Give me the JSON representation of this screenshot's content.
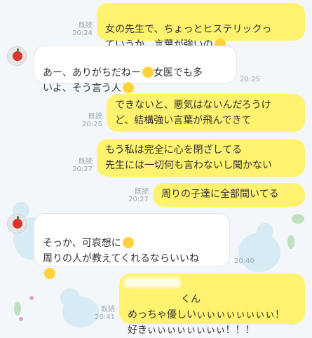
{
  "messages": [
    {
      "id": "m1",
      "side": "me",
      "lines": "女の先生で、ちょっとヒステリックっ\nていうか、言葉が強いの",
      "emoji": "crying-face-icon",
      "read": "既読",
      "time": "20:24"
    },
    {
      "id": "m2",
      "side": "them",
      "lines": "あー、ありがちだねー",
      "emoji": "grinning-sweat-icon",
      "lines2": "女医でも多\nいよ、そう言う人",
      "emoji2": "flushed-face-icon",
      "time": "20:25"
    },
    {
      "id": "m3",
      "side": "me",
      "lines": "できないと、悪気はないんだろうけ\nど、結構強い言葉が飛んできて",
      "read": "既読",
      "time": "20:25"
    },
    {
      "id": "m4",
      "side": "me",
      "lines": "もう私は完全に心を閉ざしてる\n先生には一切何も言わないし聞かない",
      "read": "既読",
      "time": "20:27"
    },
    {
      "id": "m5",
      "side": "me",
      "lines": "周りの子達に全部聞いてる",
      "read": "既読",
      "time": "20:27"
    },
    {
      "id": "m6",
      "side": "them",
      "lines": "そっか、可哀想に",
      "emoji": "pleading-face-icon",
      "lines2": "周りの人が教えてくれるならいいね",
      "emoji2": "smiling-face-icon",
      "time": "20:40"
    },
    {
      "id": "m7",
      "side": "me",
      "lines": "くん\nめっちゃ優しいぃぃぃぃぃぃぃぃ！\n好きぃぃぃぃぃぃぃぃ！！！",
      "read": "既読",
      "time": "20:41"
    }
  ],
  "colors": {
    "me": "#fff26e",
    "them": "#ffffff",
    "background": "#f3f7fa"
  }
}
